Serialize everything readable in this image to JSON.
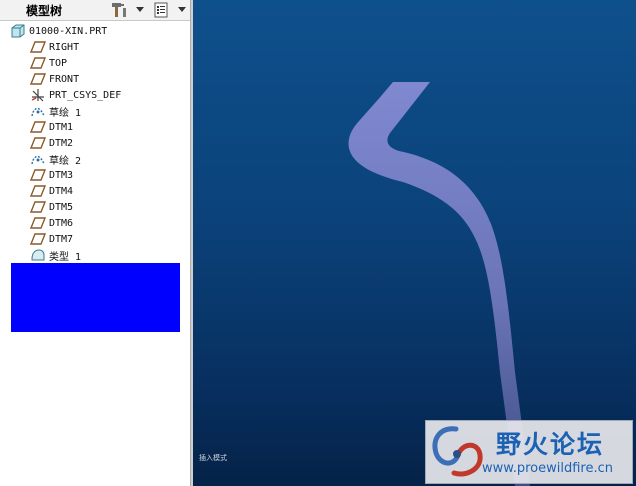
{
  "model_tree": {
    "title": "模型树",
    "root_label": "01000-XIN.PRT",
    "items": [
      {
        "label": "RIGHT",
        "icon": "datum-plane-icon"
      },
      {
        "label": "TOP",
        "icon": "datum-plane-icon"
      },
      {
        "label": "FRONT",
        "icon": "datum-plane-icon"
      },
      {
        "label": "PRT_CSYS_DEF",
        "icon": "coordinate-system-icon"
      },
      {
        "label": "草绘 1",
        "icon": "sketch-icon"
      },
      {
        "label": "DTM1",
        "icon": "datum-plane-icon"
      },
      {
        "label": "DTM2",
        "icon": "datum-plane-icon"
      },
      {
        "label": "草绘 2",
        "icon": "sketch-icon"
      },
      {
        "label": "DTM3",
        "icon": "datum-plane-icon"
      },
      {
        "label": "DTM4",
        "icon": "datum-plane-icon"
      },
      {
        "label": "DTM5",
        "icon": "datum-plane-icon"
      },
      {
        "label": "DTM6",
        "icon": "datum-plane-icon"
      },
      {
        "label": "DTM7",
        "icon": "datum-plane-icon"
      },
      {
        "label": "类型 1",
        "icon": "feature-icon"
      }
    ],
    "insert_marker_color": "#0000ff"
  },
  "toolbar": {
    "settings_icon": "hammer-icon",
    "show_icon": "list-icon"
  },
  "viewport": {
    "mode_label": "插入模式",
    "background_top": "#0e508c",
    "background_bottom": "#052247",
    "model_color": "#7b86cc"
  },
  "watermark": {
    "title": "野火论坛",
    "url": "www.proewildfire.cn",
    "accent": "#1c62b4"
  }
}
